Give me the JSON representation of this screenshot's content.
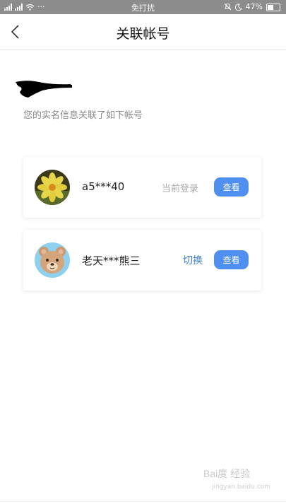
{
  "status_bar": {
    "left_text": "···",
    "center_text": "免打扰",
    "battery": "47%",
    "icons": [
      "signal-icon",
      "signal-icon",
      "wifi-icon",
      "alarm-icon",
      "moon-icon",
      "battery-icon"
    ]
  },
  "header": {
    "title": "关联帐号",
    "back_icon": "chevron-left-icon"
  },
  "main": {
    "subtitle": "您的实名信息关联了如下帐号",
    "accounts": [
      {
        "name": "a5***40",
        "status": "当前登录",
        "action_label": "查看",
        "avatar": "flower-avatar"
      },
      {
        "name": "老天***熊三",
        "switch_label": "切换",
        "action_label": "查看",
        "avatar": "bear-avatar"
      }
    ]
  },
  "watermark": {
    "text": "Bai度 经验",
    "sub": "jingyan.baidu.com"
  },
  "colors": {
    "accent": "#4f8ff0",
    "link": "#3e7fd6",
    "status_bar": "#8c8c8c"
  }
}
